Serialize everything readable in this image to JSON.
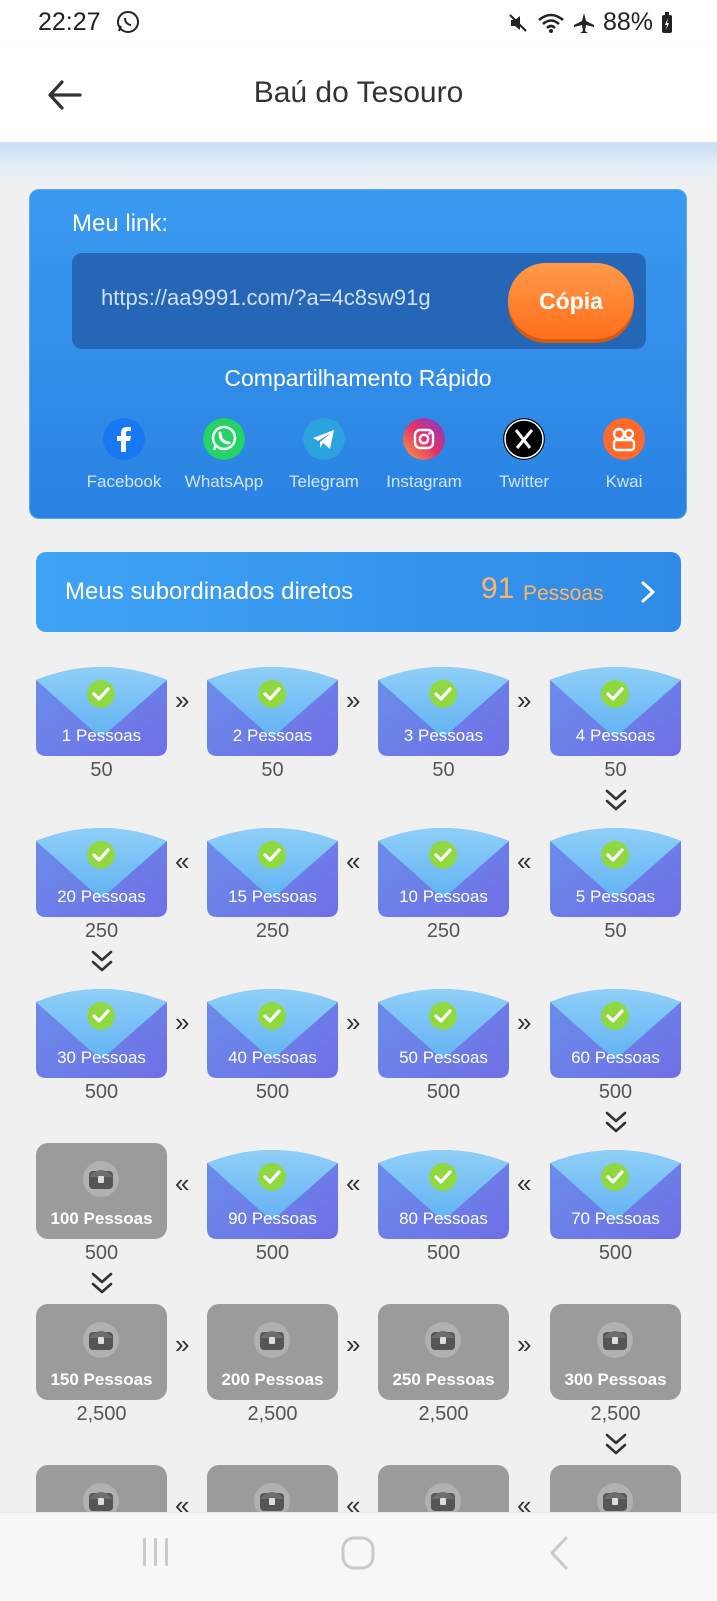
{
  "status_bar": {
    "time": "22:27",
    "battery": "88%"
  },
  "header": {
    "title": "Baú do Tesouro"
  },
  "link_card": {
    "label": "Meu link:",
    "url": "https://aa9991.com/?a=4c8sw91g",
    "copy_button": "Cópia",
    "quick_share_title": "Compartilhamento Rápido",
    "share_options": [
      {
        "label": "Facebook",
        "icon": "facebook-icon",
        "color": "#1877f2"
      },
      {
        "label": "WhatsApp",
        "icon": "whatsapp-icon",
        "color": "#25d366"
      },
      {
        "label": "Telegram",
        "icon": "telegram-icon",
        "color": "#2aa3de"
      },
      {
        "label": "Instagram",
        "icon": "instagram-icon",
        "color": "#d6249f"
      },
      {
        "label": "Twitter",
        "icon": "x-icon",
        "color": "#000000"
      },
      {
        "label": "Kwai",
        "icon": "kwai-icon",
        "color": "#ff6a2b"
      }
    ]
  },
  "subordinates": {
    "label": "Meus subordinados diretos",
    "count": "91",
    "unit": "Pessoas"
  },
  "chests": [
    [
      {
        "label": "1 Pessoas",
        "reward": "50",
        "status": "claimed"
      },
      {
        "label": "2 Pessoas",
        "reward": "50",
        "status": "claimed"
      },
      {
        "label": "3 Pessoas",
        "reward": "50",
        "status": "claimed"
      },
      {
        "label": "4 Pessoas",
        "reward": "50",
        "status": "claimed"
      }
    ],
    [
      {
        "label": "20 Pessoas",
        "reward": "250",
        "status": "claimed"
      },
      {
        "label": "15 Pessoas",
        "reward": "250",
        "status": "claimed"
      },
      {
        "label": "10 Pessoas",
        "reward": "250",
        "status": "claimed"
      },
      {
        "label": "5 Pessoas",
        "reward": "50",
        "status": "claimed"
      }
    ],
    [
      {
        "label": "30 Pessoas",
        "reward": "500",
        "status": "claimed"
      },
      {
        "label": "40 Pessoas",
        "reward": "500",
        "status": "claimed"
      },
      {
        "label": "50 Pessoas",
        "reward": "500",
        "status": "claimed"
      },
      {
        "label": "60 Pessoas",
        "reward": "500",
        "status": "claimed"
      }
    ],
    [
      {
        "label": "100 Pessoas",
        "reward": "500",
        "status": "locked"
      },
      {
        "label": "90 Pessoas",
        "reward": "500",
        "status": "claimed"
      },
      {
        "label": "80 Pessoas",
        "reward": "500",
        "status": "claimed"
      },
      {
        "label": "70 Pessoas",
        "reward": "500",
        "status": "claimed"
      }
    ],
    [
      {
        "label": "150 Pessoas",
        "reward": "2,500",
        "status": "locked"
      },
      {
        "label": "200 Pessoas",
        "reward": "2,500",
        "status": "locked"
      },
      {
        "label": "250 Pessoas",
        "reward": "2,500",
        "status": "locked"
      },
      {
        "label": "300 Pessoas",
        "reward": "2,500",
        "status": "locked"
      }
    ],
    [
      {
        "label": "",
        "reward": "",
        "status": "locked"
      },
      {
        "label": "",
        "reward": "",
        "status": "locked"
      },
      {
        "label": "",
        "reward": "",
        "status": "locked"
      },
      {
        "label": "",
        "reward": "",
        "status": "locked"
      }
    ]
  ],
  "colors": {
    "accent": "#2a82e2",
    "copy": "#ff7a25",
    "count": "#ffb564",
    "claimed_top": "#7cc3f7",
    "claimed_bottom": "#6f6fe6",
    "locked": "#9b9b9b"
  },
  "nav": {
    "recent": "recent-apps-icon",
    "home": "home-icon",
    "back": "back-icon"
  }
}
